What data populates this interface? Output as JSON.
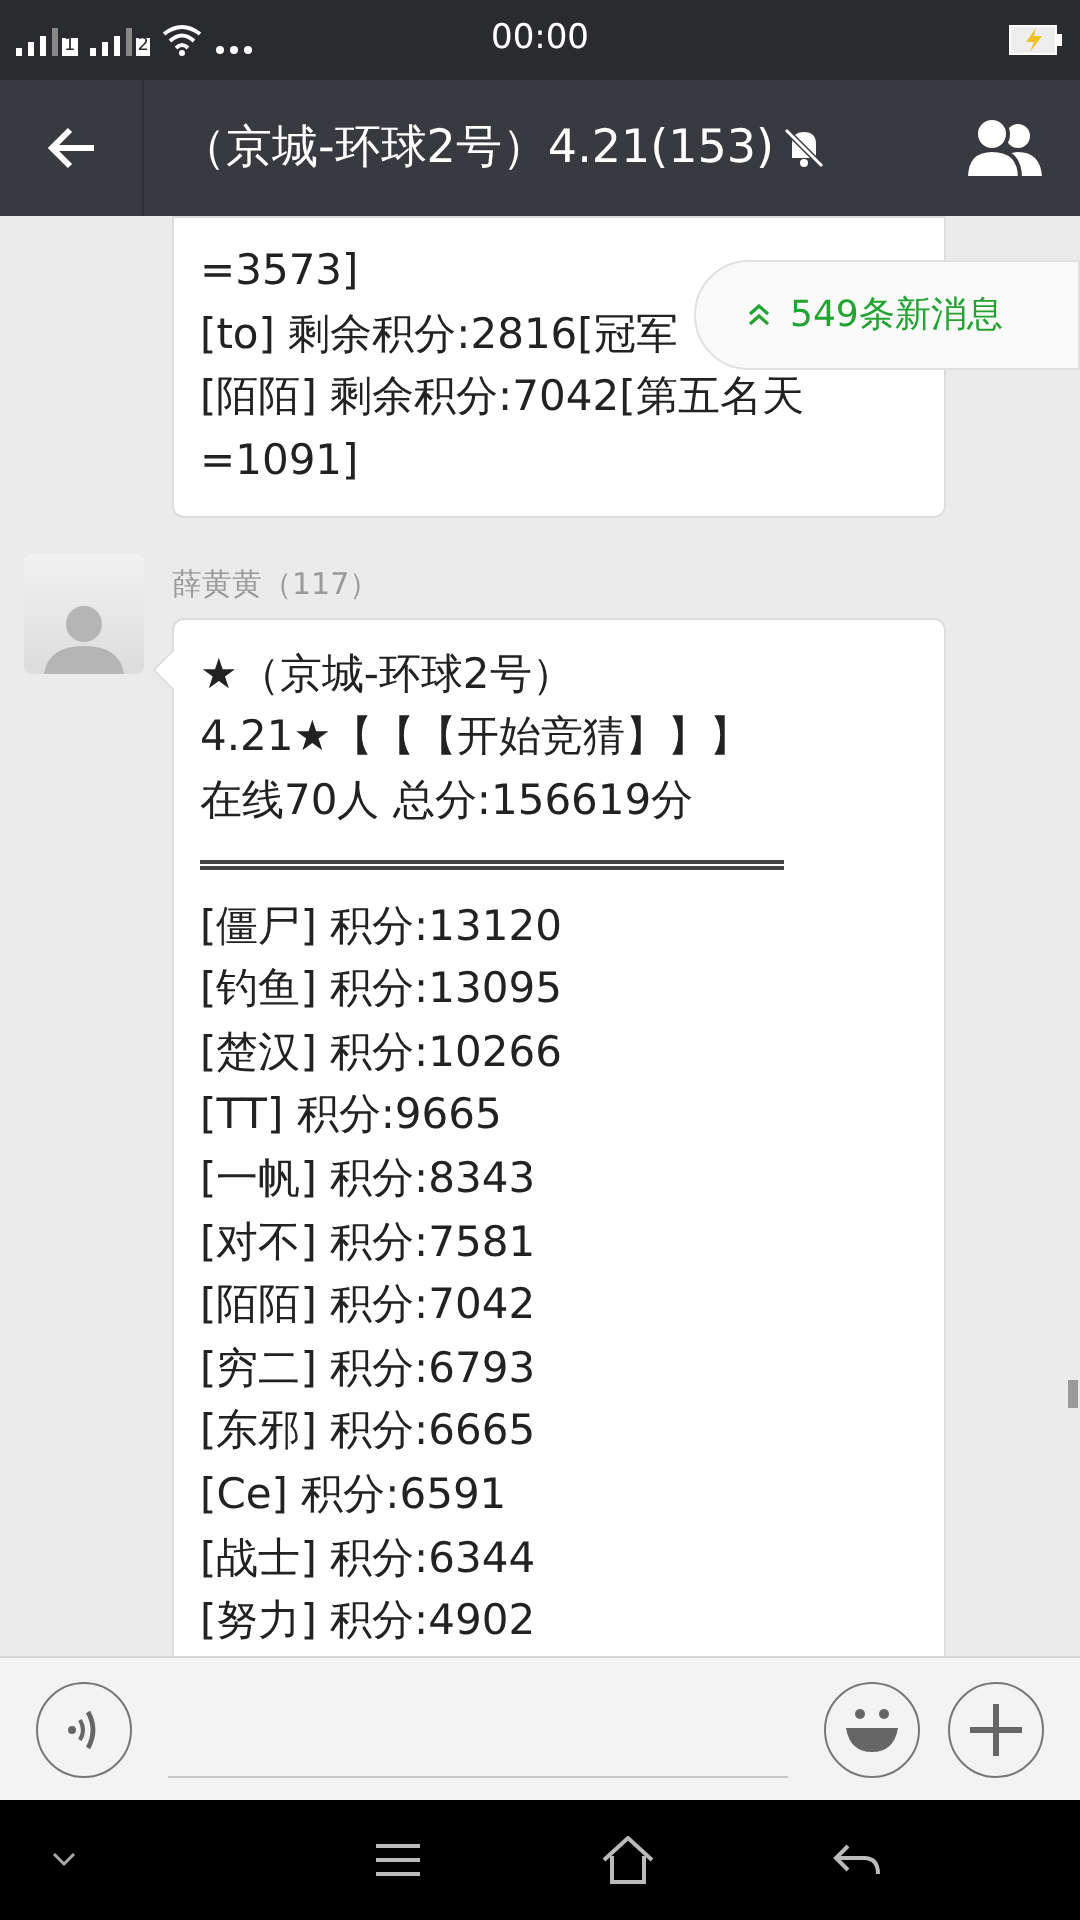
{
  "status_bar": {
    "time": "00:00",
    "sim_labels": [
      "1",
      "2"
    ]
  },
  "header": {
    "title": "（京城-环球2号）4.21(153)",
    "muted": true
  },
  "new_messages_badge": {
    "text": "549条新消息"
  },
  "messages": [
    {
      "lines": [
        "=3573]",
        "[to] 剩余积分:2816[冠军",
        "[陌陌] 剩余积分:7042[第五名天",
        "=1091]"
      ]
    },
    {
      "sender": "薛黄黄（117）",
      "lines": [
        "★（京城-环球2号）",
        "4.21★【【【开始竞猜】】】",
        "在线70人  总分:156619分"
      ],
      "divider": true,
      "scores": [
        "[僵尸] 积分:13120",
        "[钓鱼] 积分:13095",
        "[楚汉] 积分:10266",
        "[TT] 积分:9665",
        "[一帆] 积分:8343",
        "[对不] 积分:7581",
        "[陌陌] 积分:7042",
        "[穷二] 积分:6793",
        "[东邪] 积分:6665",
        "[Ce] 积分:6591",
        "[战士] 积分:6344",
        "[努力] 积分:4902"
      ]
    }
  ]
}
